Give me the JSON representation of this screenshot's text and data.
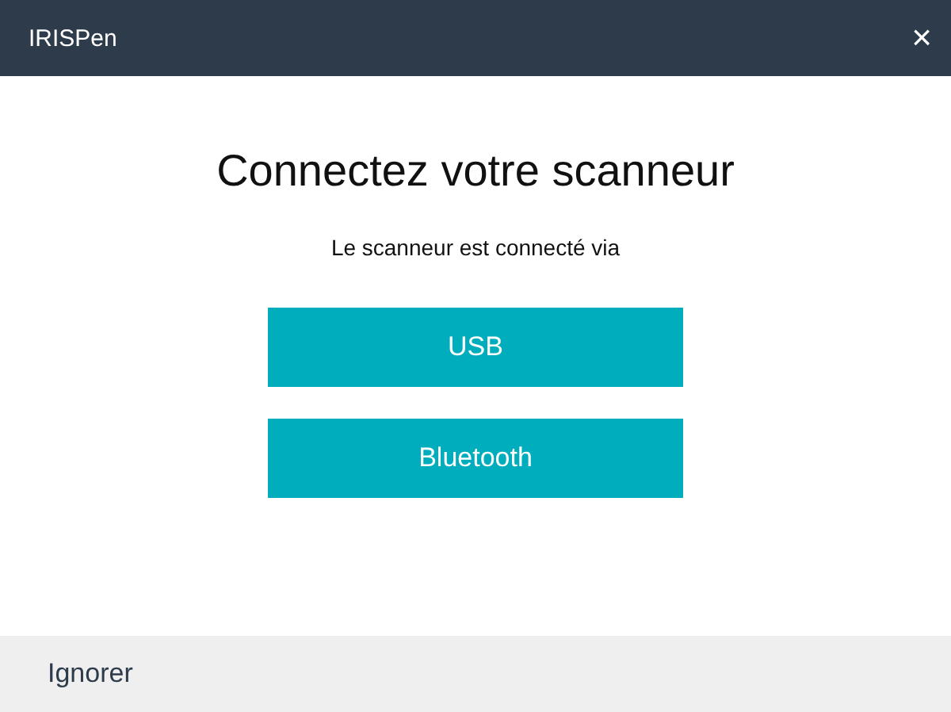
{
  "window": {
    "title": "IRISPen",
    "close": "×"
  },
  "heading": "Connectez votre scanneur",
  "subtitle": "Le scanneur est connecté via",
  "buttons": [
    "USB",
    "Bluetooth"
  ],
  "footer": {
    "link": "Ignorer"
  }
}
